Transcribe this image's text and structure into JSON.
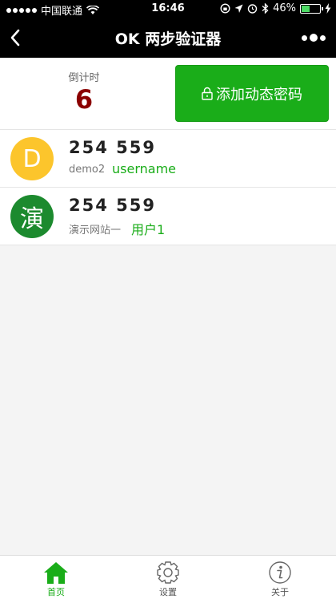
{
  "status_bar": {
    "carrier": "中国联通",
    "time": "16:46",
    "battery": "46%",
    "battery_level": 0.46
  },
  "nav": {
    "title": "OK 两步验证器"
  },
  "header": {
    "countdown_label": "倒计时",
    "countdown_value": "6",
    "add_button_label": "添加动态密码"
  },
  "accounts": [
    {
      "avatar_letter": "D",
      "avatar_color": "#fcc52c",
      "code": "254 559",
      "site": "demo2",
      "user": "username"
    },
    {
      "avatar_letter": "演",
      "avatar_color": "#1c8a2e",
      "code": "254 559",
      "site": "演示网站一",
      "user": "用户1"
    }
  ],
  "tabs": [
    {
      "label": "首页",
      "icon": "home-icon",
      "active": true
    },
    {
      "label": "设置",
      "icon": "gear-icon",
      "active": false
    },
    {
      "label": "关于",
      "icon": "info-icon",
      "active": false
    }
  ],
  "colors": {
    "accent": "#1aad19",
    "countdown": "#8b0000"
  }
}
